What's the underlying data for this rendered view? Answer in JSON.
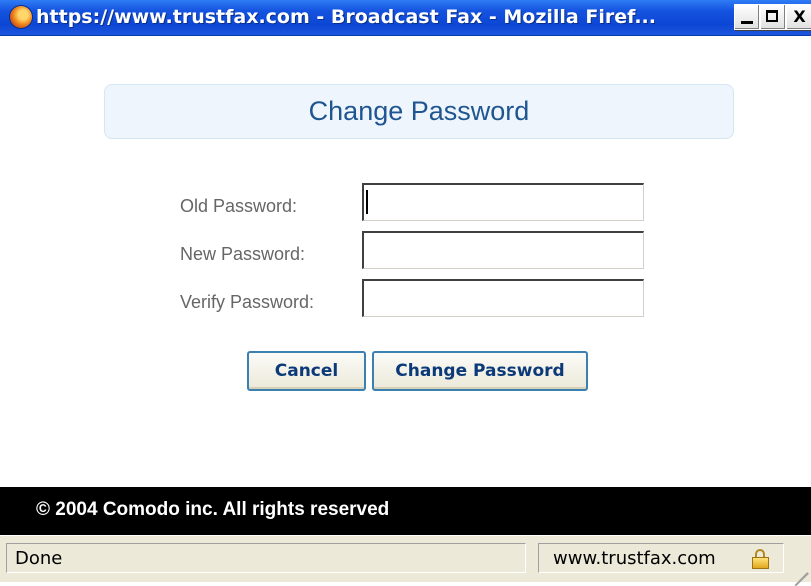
{
  "window": {
    "title": "https://www.trustfax.com - Broadcast Fax - Mozilla Firef...",
    "controls": {
      "minimize": "minimize",
      "maximize": "maximize",
      "close": "X"
    }
  },
  "page": {
    "heading": "Change Password",
    "form": {
      "old_password_label": "Old Password:",
      "new_password_label": "New Password:",
      "verify_password_label": "Verify Password:",
      "old_password_value": "",
      "new_password_value": "",
      "verify_password_value": ""
    },
    "buttons": {
      "cancel_label": "Cancel",
      "change_label": "Change Password"
    },
    "footer": "© 2004 Comodo inc. All rights reserved"
  },
  "statusbar": {
    "status": "Done",
    "domain": "www.trustfax.com",
    "security_icon": "lock-icon"
  },
  "colors": {
    "titlebar": "#0c46d4",
    "heading_text": "#1f5591",
    "heading_bg": "#eef5fc",
    "button_text": "#0c3a78",
    "button_border": "#3c7fb1",
    "footer_bg": "#000000"
  }
}
